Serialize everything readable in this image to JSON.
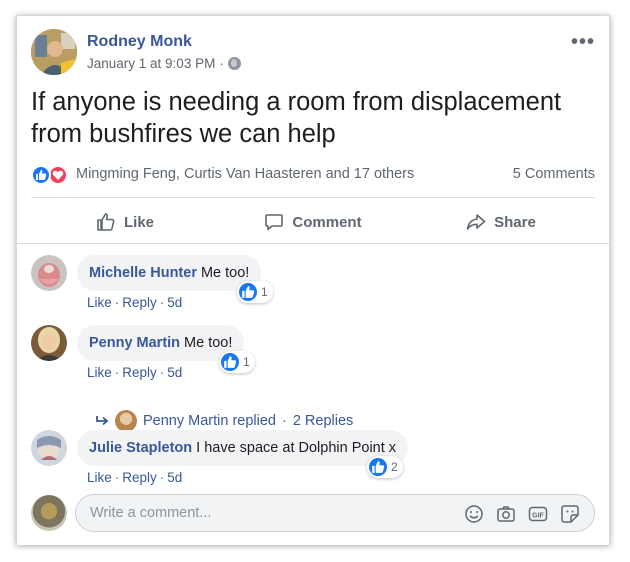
{
  "post": {
    "author": "Rodney Monk",
    "timestamp": "January 1 at 9:03 PM",
    "separator": "·",
    "more_label": "•••",
    "text": "If anyone is needing a room from displacement from bushfires we can help"
  },
  "reactions": {
    "names": "Mingming Feng, Curtis Van Haasteren and 17 others",
    "comments_count": "5 Comments"
  },
  "actions": {
    "like": "Like",
    "comment": "Comment",
    "share": "Share"
  },
  "comments": [
    {
      "name": "Michelle Hunter",
      "text": "Me too!",
      "like": "Like",
      "reply": "Reply",
      "time": "5d",
      "reaction_count": "1"
    },
    {
      "name": "Penny Martin",
      "text": "Me too!",
      "like": "Like",
      "reply": "Reply",
      "time": "5d",
      "reaction_count": "1"
    },
    {
      "name": "Julie Stapleton",
      "text": "I have space at Dolphin Point x",
      "like": "Like",
      "reply": "Reply",
      "time": "5d",
      "reaction_count": "2"
    }
  ],
  "replied": {
    "name": "Penny Martin replied",
    "separator": "·",
    "replies": "2 Replies"
  },
  "composer": {
    "placeholder": "Write a comment...",
    "gif_label": "GIF"
  },
  "colors": {
    "link": "#385898",
    "like_blue": "#1877f2",
    "love_red": "#f33e58"
  }
}
